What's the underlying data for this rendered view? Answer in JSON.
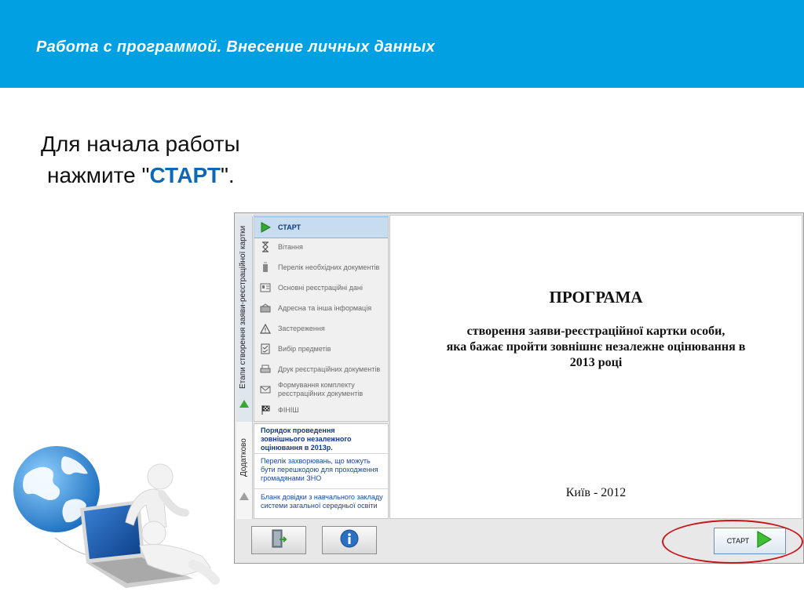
{
  "header": {
    "title": "Работа с программой. Внесение личных данных"
  },
  "instruction": {
    "line1": "Для начала работы",
    "line2_prefix": "нажмите \"",
    "line2_keyword": "СТАРТ",
    "line2_suffix": "\"."
  },
  "app": {
    "tabs": [
      {
        "label": "Етапи створення заяви-реєстраційної картки"
      },
      {
        "label": "Додатково"
      }
    ],
    "steps": [
      {
        "label": "СТАРТ",
        "icon": "play-icon",
        "active": true
      },
      {
        "label": "Вітання",
        "icon": "hourglass-icon"
      },
      {
        "label": "Перелік необхідних документів",
        "icon": "paper-icon"
      },
      {
        "label": "Основні реєстраційні дані",
        "icon": "id-card-icon"
      },
      {
        "label": "Адресна та інша інформація",
        "icon": "address-icon"
      },
      {
        "label": "Застереження",
        "icon": "warning-icon"
      },
      {
        "label": "Вибір предметів",
        "icon": "checklist-icon"
      },
      {
        "label": "Друк реєстраційних документів",
        "icon": "printer-icon"
      },
      {
        "label": "Формування комплекту реєстраційних документів",
        "icon": "envelope-icon"
      },
      {
        "label": "ФІНІШ",
        "icon": "finish-flag-icon"
      }
    ],
    "links": [
      {
        "label": "Порядок проведення зовнішнього незалежного оцінювання  в 2013р."
      },
      {
        "label": "Перелік захворювань, що можуть бути перешкодою для проходження громадянами ЗНО"
      },
      {
        "label": "Бланк довідки з навчального закладу системи загальної середньої освіти"
      }
    ],
    "document": {
      "title": "ПРОГРАМА",
      "line1": "створення заяви-реєстраційної картки особи,",
      "line2": "яка бажає пройти зовнішнє незалежне оцінювання в",
      "line3": "2013 році",
      "footer": "Київ - 2012"
    },
    "buttons": {
      "exit_icon": "exit-door-icon",
      "info_icon": "info-icon",
      "start_label": "СТАРТ"
    }
  },
  "colors": {
    "banner": "#00a0e3",
    "keyword": "#0f68b5",
    "highlight_oval": "#c9141c",
    "play_green": "#35a92f"
  }
}
